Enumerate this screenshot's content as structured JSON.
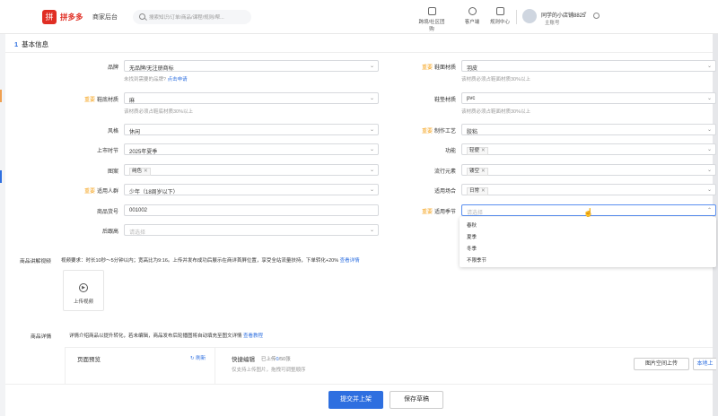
{
  "header": {
    "logo_glyph": "拼",
    "brand": "拼多多",
    "brand_sub": "商家后台",
    "search_placeholder": "搜索知识/订单/商品/课程/规则/帮...",
    "nav": [
      {
        "icon": "cross-border-icon",
        "label": "跨境/社区团购"
      },
      {
        "icon": "customer-service-icon",
        "label": "客户端"
      },
      {
        "icon": "rules-center-icon",
        "label": "规则中心"
      }
    ],
    "user_name": "同学的小店铺8825",
    "user_role": "主账号"
  },
  "section": {
    "num": "1",
    "title": "基本信息"
  },
  "required_mark": "重要",
  "fields": {
    "brand": {
      "label": "品牌",
      "value": "无品牌/无注册商标",
      "hint": "未找到需要的品牌?",
      "hint_link": "点击申请"
    },
    "upper": {
      "label": "鞋面材质",
      "value": "羽皮",
      "hint": "该材质必须占鞋面材质30%以上"
    },
    "lining": {
      "label": "鞋底材质",
      "value": "麻",
      "hint": "该材质必须占鞋底材质30%以上"
    },
    "insole": {
      "label": "鞋垫材质",
      "value": "pvc",
      "hint": "该材质必须占鞋面材质30%以上"
    },
    "style": {
      "label": "风格",
      "value": "休闲"
    },
    "craft": {
      "label": "制作工艺",
      "value": "胶粘"
    },
    "season_launch": {
      "label": "上市时节",
      "value": "2025年夏季"
    },
    "function": {
      "label": "功能",
      "tag": "轻便"
    },
    "pattern": {
      "label": "图案",
      "tag": "纯色"
    },
    "trend": {
      "label": "流行元素",
      "tag": "镂空"
    },
    "crowd": {
      "label": "适用人群",
      "value": "少年（18周岁以下）"
    },
    "scene": {
      "label": "适用场合",
      "tag": "日常"
    },
    "item_no": {
      "label": "商品货号",
      "value": "001002"
    },
    "season": {
      "label": "适用季节",
      "placeholder": "请选择"
    },
    "heel": {
      "label": "后跟高",
      "placeholder": "请选择"
    }
  },
  "season_options": [
    "春秋",
    "夏季",
    "冬季",
    "不限季节"
  ],
  "video": {
    "label": "商品讲解视频",
    "desc": "视频要求：时长10秒～5分钟以内；宽高比为9:16。上传并发布成功后展示在商详首屏位置，享受全站流量扶持，下单转化+20%",
    "link": "查看详情",
    "upload_label": "上传视频"
  },
  "detail": {
    "label": "商品详情",
    "desc": "详情介绍商品以提升转化，若未编辑，商品发布后轮播图将自动填充至图文详情",
    "link": "查看教程",
    "preview_title": "页面预览",
    "refresh": "刷新",
    "quick_edit": "快捷编辑",
    "uploaded_prefix": "已上传",
    "uploaded_count": "0",
    "uploaded_total": "/50张",
    "upload_hint": "仅支持上传图片，拖拽可调整顺序",
    "btn_space": "图片空间上传",
    "btn_local": "本地上"
  },
  "footer": {
    "submit": "提交并上架",
    "save": "保存草稿"
  }
}
